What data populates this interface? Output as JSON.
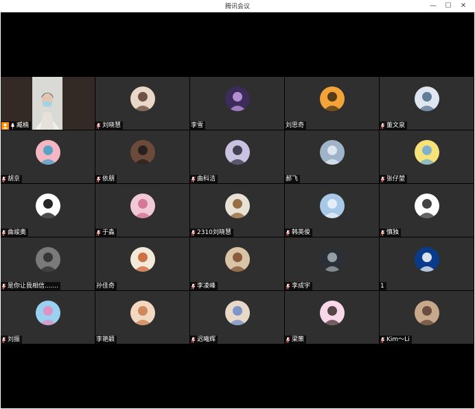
{
  "window": {
    "title": "腾讯会议",
    "minimize_symbol": "—",
    "maximize_symbol": "☐",
    "close_symbol": "✕"
  },
  "colors": {
    "stage_bg": "#000000",
    "tile_bg": "#2f2f2f",
    "host_badge": "#ff8c00"
  },
  "participants": [
    {
      "name": "臧楠",
      "icon": "mic-on-icon",
      "video": true,
      "host": true
    },
    {
      "name": "刘晓慧",
      "icon": "mic-muted-icon"
    },
    {
      "name": "李雪",
      "icon": "none"
    },
    {
      "name": "刘思奇",
      "icon": "none"
    },
    {
      "name": "董文泉",
      "icon": "mic-muted-icon"
    },
    {
      "name": "胡京",
      "icon": "mic-muted-icon"
    },
    {
      "name": "依朋",
      "icon": "mic-muted-icon"
    },
    {
      "name": "曲科洁",
      "icon": "mic-muted-icon"
    },
    {
      "name": "郝飞",
      "icon": "none"
    },
    {
      "name": "张仔堃",
      "icon": "mic-muted-icon"
    },
    {
      "name": "曲竣奥",
      "icon": "mic-muted-icon"
    },
    {
      "name": "于淼",
      "icon": "mic-muted-icon"
    },
    {
      "name": "2310刘晓慧",
      "icon": "mic-muted-icon"
    },
    {
      "name": "韩英俊",
      "icon": "mic-muted-icon"
    },
    {
      "name": "慎独",
      "icon": "mic-muted-icon"
    },
    {
      "name": "是你让我相信.......",
      "icon": "mic-muted-icon"
    },
    {
      "name": "孙佳奇",
      "icon": "none"
    },
    {
      "name": "李凌峰",
      "icon": "mic-muted-icon"
    },
    {
      "name": "李成宇",
      "icon": "mic-muted-icon"
    },
    {
      "name": "1",
      "icon": "none"
    },
    {
      "name": "刘振",
      "icon": "mic-muted-icon"
    },
    {
      "name": "李艳颖",
      "icon": "none"
    },
    {
      "name": "迟曦辉",
      "icon": "mic-muted-icon"
    },
    {
      "name": "梁策",
      "icon": "mic-muted-icon"
    },
    {
      "name": "Kim～Li",
      "icon": "mic-muted-icon"
    }
  ]
}
